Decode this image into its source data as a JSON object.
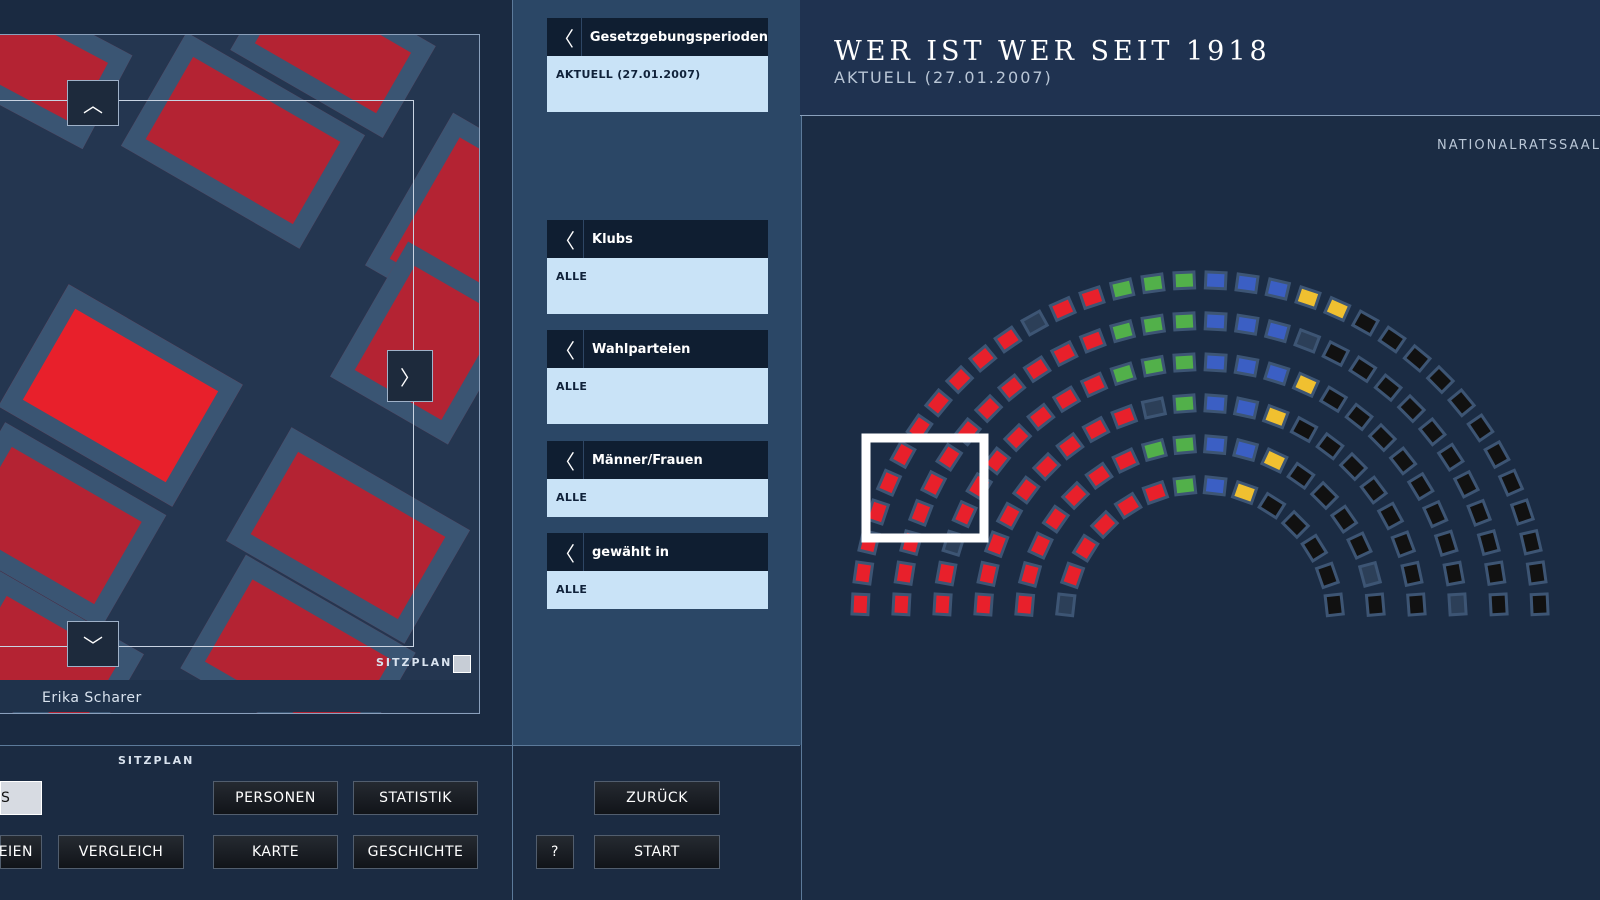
{
  "header": {
    "title": "WER IST WER SEIT 1918",
    "subtitle": "AKTUELL (27.01.2007)",
    "hall_label": "NATIONALRATSSAAL"
  },
  "zoom": {
    "person_name": "Erika Scharer",
    "sitzplan_label": "SITZPLAN"
  },
  "filters": [
    {
      "title": "Gesetzgebungsperioden",
      "value": "AKTUELL (27.01.2007)"
    },
    {
      "title": "Klubs",
      "value": "ALLE"
    },
    {
      "title": "Wahlparteien",
      "value": "ALLE"
    },
    {
      "title": "Männer/Frauen",
      "value": "ALLE"
    },
    {
      "title": "gewählt in",
      "value": "ALLE"
    }
  ],
  "bottom": {
    "sitzplan_label": "SITZPLAN",
    "btn_partial_top": "S",
    "btn_partial_bottom": "TEIEN",
    "vergleich": "VERGLEICH",
    "personen": "PERSONEN",
    "statistik": "STATISTIK",
    "karte": "KARTE",
    "geschichte": "GESCHICHTE",
    "help": "?",
    "zurueck": "ZURÜCK",
    "start": "START"
  },
  "colors": {
    "spoe": "#e8202b",
    "oevp": "#111111",
    "gruene": "#52b04a",
    "fpoe": "#3b5fc4",
    "bzoe": "#f0c030",
    "empty": "#2c3f58"
  },
  "icons": {
    "back": "chevron-left-icon",
    "up": "chevron-up-icon",
    "down": "chevron-down-icon",
    "right": "chevron-right-icon"
  }
}
